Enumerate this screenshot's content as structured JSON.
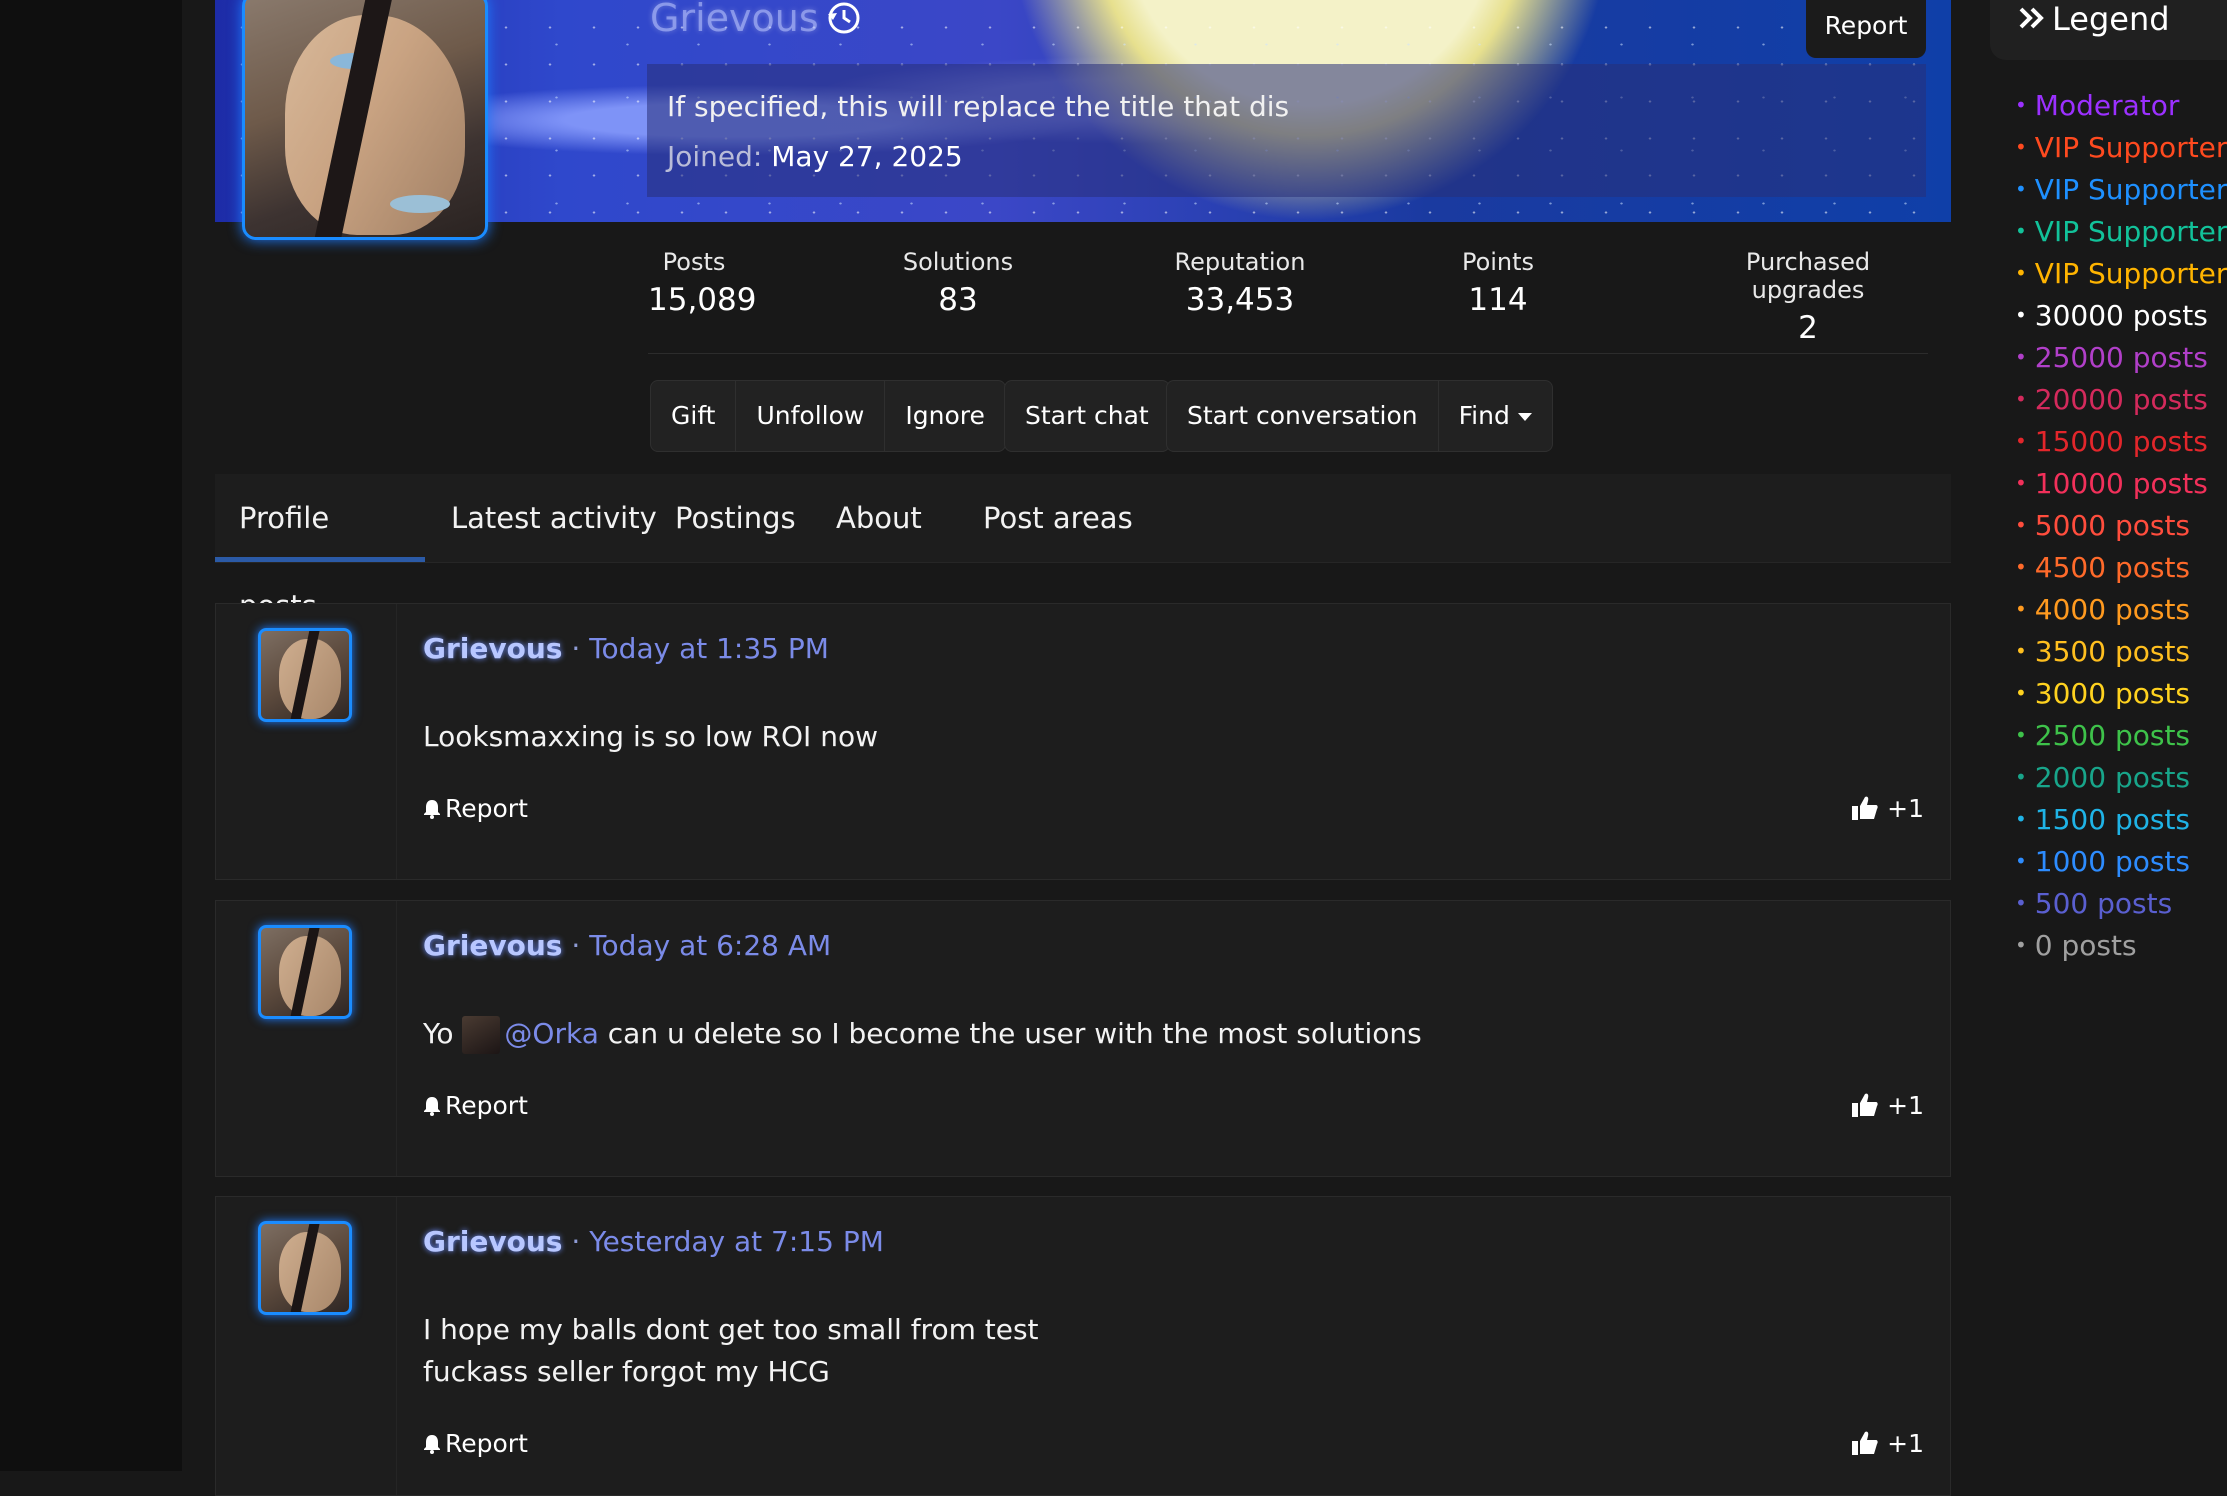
{
  "profile": {
    "username": "Grievous",
    "custom_title": "If specified, this will replace the title that dis",
    "joined_label": "Joined:",
    "joined_date": "May 27, 2025",
    "report_label": "Report"
  },
  "stats": [
    {
      "label": "Posts",
      "value": "15,089"
    },
    {
      "label": "Solutions",
      "value": "83"
    },
    {
      "label": "Reputation",
      "value": "33,453"
    },
    {
      "label": "Points",
      "value": "114"
    },
    {
      "label": "Purchased upgrades",
      "value": "2"
    }
  ],
  "actions": {
    "gift": "Gift",
    "unfollow": "Unfollow",
    "ignore": "Ignore",
    "start_chat": "Start chat",
    "start_conversation": "Start conversation",
    "find": "Find"
  },
  "tabs": [
    "Profile posts",
    "Latest activity",
    "Postings",
    "About",
    "Post areas"
  ],
  "posts": [
    {
      "author": "Grievous",
      "separator": "·",
      "time": "Today at 1:35 PM",
      "text": "Looksmaxxing is so low ROI now",
      "report": "Report",
      "likes": "+1"
    },
    {
      "author": "Grievous",
      "separator": "·",
      "time": "Today at 6:28 AM",
      "text_before": "Yo",
      "mention": "@Orka",
      "text_after": "can u delete so I become the user with the most solutions",
      "report": "Report",
      "likes": "+1"
    },
    {
      "author": "Grievous",
      "separator": "·",
      "time": "Yesterday at 7:15 PM",
      "line1": "I hope my balls dont get too small from test",
      "line2": "fuckass seller forgot my HCG",
      "report": "Report",
      "likes": "+1"
    }
  ],
  "legend": {
    "title": "Legend",
    "items": [
      {
        "label": "Moderator",
        "color": "#9b30ff"
      },
      {
        "label": "VIP Supporter",
        "color": "#ff4a1f"
      },
      {
        "label": "VIP Supporter",
        "color": "#1e90ff"
      },
      {
        "label": "VIP Supporter",
        "color": "#12c29a"
      },
      {
        "label": "VIP Supporter",
        "color": "#ffb400"
      },
      {
        "label": "30000 posts",
        "color": "#ffffff"
      },
      {
        "label": "25000 posts",
        "color": "#b13fc9"
      },
      {
        "label": "20000 posts",
        "color": "#d42a5c"
      },
      {
        "label": "15000 posts",
        "color": "#e3262b"
      },
      {
        "label": "10000 posts",
        "color": "#f2305a"
      },
      {
        "label": "5000 posts",
        "color": "#ff4d3d"
      },
      {
        "label": "4500 posts",
        "color": "#ff6a2a"
      },
      {
        "label": "4000 posts",
        "color": "#ff9a1f"
      },
      {
        "label": "3500 posts",
        "color": "#ffbf1f"
      },
      {
        "label": "3000 posts",
        "color": "#ffd21f"
      },
      {
        "label": "2500 posts",
        "color": "#3ec24a"
      },
      {
        "label": "2000 posts",
        "color": "#18a58a"
      },
      {
        "label": "1500 posts",
        "color": "#1fb3e6"
      },
      {
        "label": "1000 posts",
        "color": "#2d8cff"
      },
      {
        "label": "500 posts",
        "color": "#5a5fd0"
      },
      {
        "label": "0 posts",
        "color": "#a0a0a0"
      }
    ]
  }
}
